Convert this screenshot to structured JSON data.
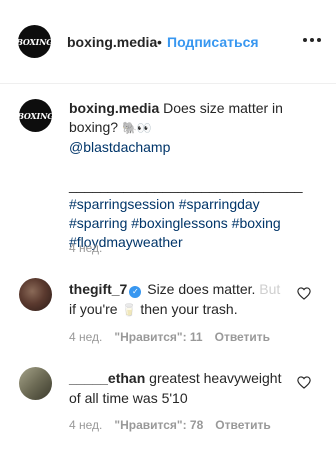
{
  "header": {
    "avatar_logo": "BOXING",
    "username": "boxing.media",
    "separator": "•",
    "follow_label": "Подписаться",
    "more_icon": "more-horizontal-icon"
  },
  "caption": {
    "avatar_logo": "BOXING",
    "username": "boxing.media",
    "text": "Does size matter in boxing?",
    "emojis": "🐘👀",
    "mention": "@blastdachamp",
    "divider": "______________________________",
    "hashtags": [
      "#sparringsession",
      "#sparringday",
      "#sparring",
      "#boxinglessons",
      "#boxing",
      "#floydmayweather"
    ],
    "time": "4 нед."
  },
  "comments": [
    {
      "username": "thegift_7",
      "verified": true,
      "text_visible": "Size does matter.",
      "text_faded": "But",
      "text_line2_a": "if you're",
      "emoji": "🥛",
      "text_line2_b": "then your trash.",
      "time": "4 нед.",
      "likes": "\"Нравится\": 11",
      "reply": "Ответить"
    },
    {
      "username": "_____ethan",
      "verified": false,
      "text": "greatest heavyweight of all time was 5'10",
      "time": "4 нед.",
      "likes": "\"Нравится\": 78",
      "reply": "Ответить"
    }
  ],
  "colors": {
    "link": "#003569",
    "follow": "#3897f0",
    "muted": "#999999"
  }
}
